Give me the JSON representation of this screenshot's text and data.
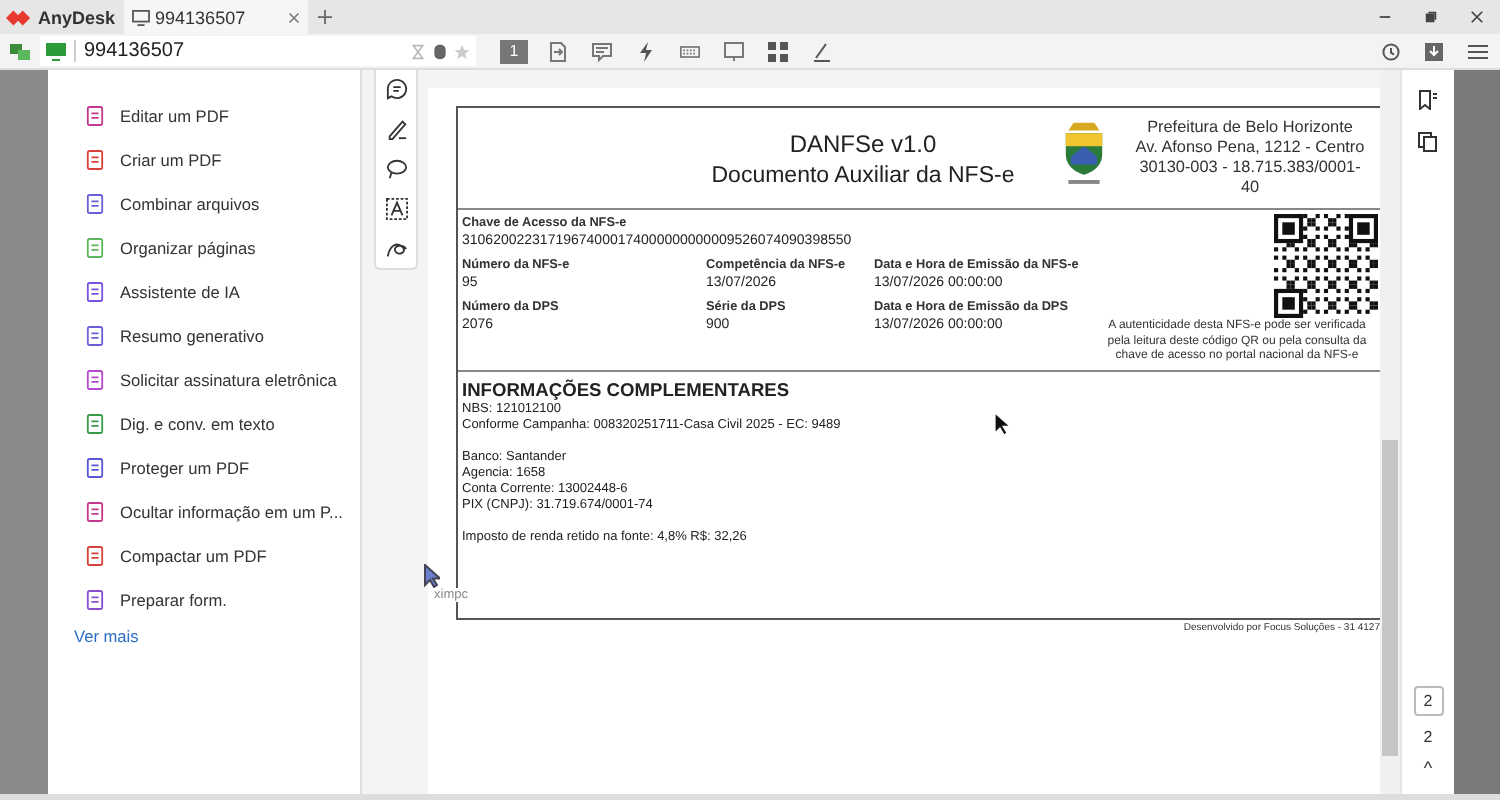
{
  "titlebar": {
    "app_name": "AnyDesk",
    "tabs": [
      {
        "label": "994136507",
        "selected": true
      }
    ]
  },
  "toolbar": {
    "address": "994136507",
    "display_number": "1"
  },
  "sidebar": {
    "items": [
      {
        "label": "Editar um PDF",
        "color": "#c2398f"
      },
      {
        "label": "Criar um PDF",
        "color": "#d8413a"
      },
      {
        "label": "Combinar arquivos",
        "color": "#6a5fd8"
      },
      {
        "label": "Organizar páginas",
        "color": "#5cb85c"
      },
      {
        "label": "Assistente de IA",
        "color": "#7b52e0"
      },
      {
        "label": "Resumo generativo",
        "color": "#6a5fd8"
      },
      {
        "label": "Solicitar assinatura eletrônica",
        "color": "#b848d0"
      },
      {
        "label": "Dig. e conv. em texto",
        "color": "#3a9a4a"
      },
      {
        "label": "Proteger um PDF",
        "color": "#5858d6"
      },
      {
        "label": "Ocultar informação em um P...",
        "color": "#c2398f"
      },
      {
        "label": "Compactar um PDF",
        "color": "#d8413a"
      },
      {
        "label": "Preparar form.",
        "color": "#8a4fd0"
      }
    ],
    "more_link": "Ver mais"
  },
  "document": {
    "title": "DANFSe v1.0",
    "subtitle": "Documento Auxiliar da NFS-e",
    "issuer_lines": [
      "Prefeitura de Belo Horizonte",
      "Av. Afonso Pena, 1212 - Centro",
      "30130-003 - 18.715.383/0001-",
      "40"
    ],
    "access_key_label": "Chave de Acesso da NFS-e",
    "access_key": "31062002231719674000174000000000009526074090398550",
    "fields": [
      {
        "label": "Número da NFS-e",
        "value": "95"
      },
      {
        "label": "Competência da NFS-e",
        "value": "13/07/2026"
      },
      {
        "label": "Data e Hora de Emissão da NFS-e",
        "value": "13/07/2026 00:00:00"
      },
      {
        "label": "Número da DPS",
        "value": "2076"
      },
      {
        "label": "Série da DPS",
        "value": "900"
      },
      {
        "label": "Data e Hora de Emissão da DPS",
        "value": "13/07/2026 00:00:00"
      }
    ],
    "qr_caption": [
      "A autenticidade desta NFS-e pode ser verificada",
      "pela leitura deste código QR ou pela consulta da",
      "chave de acesso no portal nacional da NFS-e"
    ],
    "info_title": "INFORMAÇÕES COMPLEMENTARES",
    "info_paragraphs": [
      {
        "lines": [
          "NBS: 121012100",
          "Conforme Campanha: 008320251711-Casa Civil 2025 - EC: 9489"
        ]
      },
      {
        "lines": [
          "Banco: Santander",
          "Agencia: 1658",
          "Conta Corrente: 13002448-6",
          "PIX (CNPJ): 31.719.674/0001-74"
        ]
      },
      {
        "lines": [
          "Imposto de renda retido na fonte: 4,8% R$: 32,26"
        ]
      }
    ],
    "footer": "Desenvolvido por Focus Soluções - 31 4127"
  },
  "cursor_label": "ximpc",
  "page_nav": {
    "current": "2",
    "total": "2",
    "up": "^"
  }
}
